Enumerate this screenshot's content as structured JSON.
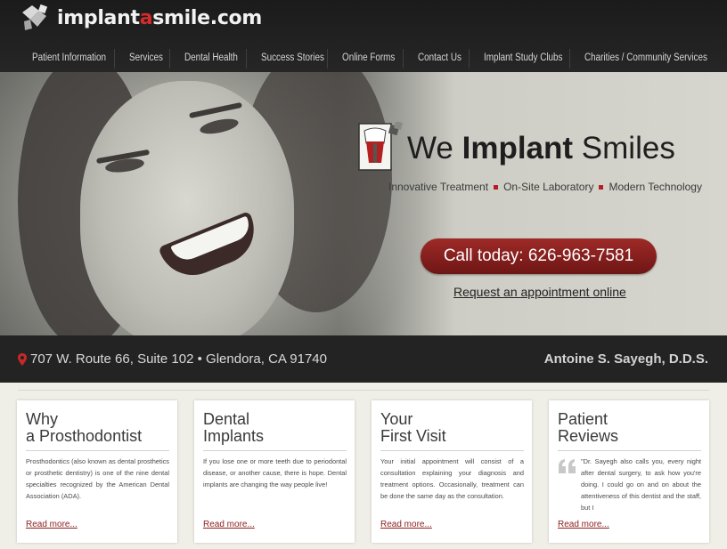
{
  "header": {
    "logo_prefix": "implant",
    "logo_a": "a",
    "logo_suffix": "smile.com",
    "nav": [
      {
        "label": "Patient Information"
      },
      {
        "label": "Services"
      },
      {
        "label": "Dental Health"
      },
      {
        "label": "Success Stories"
      },
      {
        "label": "Online Forms"
      },
      {
        "label": "Contact Us"
      },
      {
        "label": "Implant Study Clubs"
      },
      {
        "label": "Charities / Community Services"
      }
    ]
  },
  "hero": {
    "tagline_we": "We",
    "tagline_implant": "Implant",
    "tagline_smiles": "Smiles",
    "features": [
      "Innovative Treatment",
      "On-Site Laboratory",
      "Modern Technology"
    ],
    "call_button": "Call today: 626-963-7581",
    "appointment_link": "Request an appointment online"
  },
  "address_bar": {
    "address": "707 W. Route 66, Suite 102 • Glendora, CA 91740",
    "doctor": "Antoine S. Sayegh, D.D.S."
  },
  "cards": [
    {
      "title_line1": "Why",
      "title_line2": "a Prosthodontist",
      "body": "Prosthodontics (also known as dental prosthetics or prosthetic dentistry) is one of the nine dental specialties recognized by the American Dental Association (ADA).",
      "link": "Read more..."
    },
    {
      "title_line1": "Dental",
      "title_line2": "Implants",
      "body": "If you lose one or more teeth due to periodontal disease, or another cause, there is hope. Dental implants are changing the way people live!",
      "link": "Read more..."
    },
    {
      "title_line1": "Your",
      "title_line2": "First Visit",
      "body": "Your initial appointment will consist of a consultation explaining your diagnosis and treatment options. Occasionally, treatment can be done the same day as the consultation.",
      "link": "Read more..."
    },
    {
      "title_line1": "Patient",
      "title_line2": "Reviews",
      "body": "\"Dr. Sayegh also calls you, every night after dental surgery, to ask how you're doing. I could go on and on about the attentiveness of this dentist and the staff, but I",
      "link": "Read more..."
    }
  ],
  "colors": {
    "accent_red": "#b3201f",
    "header_dark": "#1b1b1b",
    "call_button": "#8a201e"
  },
  "icons": [
    "logo-mark-icon",
    "tooth-implant-icon",
    "map-pin-icon",
    "quote-icon"
  ]
}
